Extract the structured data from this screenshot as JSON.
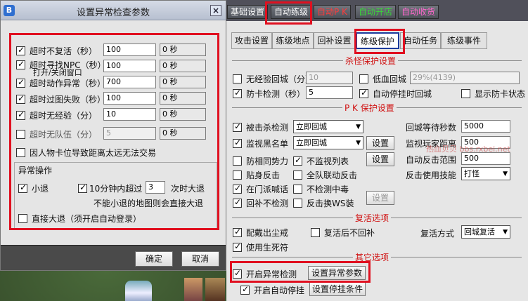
{
  "dialog": {
    "title": "设置异常检查参数",
    "app_icon_text": "B",
    "rows": [
      {
        "label": "超时不复活（秒）",
        "checked": true,
        "value": "100",
        "seconds": "0 秒"
      },
      {
        "label": "超时寻找NPC（秒）",
        "label2": "打开/关闭窗口",
        "checked": true,
        "value": "100",
        "seconds": "0 秒"
      },
      {
        "label": "超时动作异常（秒）",
        "checked": true,
        "value": "700",
        "seconds": "0 秒"
      },
      {
        "label": "超时过图失败（秒）",
        "checked": true,
        "value": "100",
        "seconds": "0 秒"
      },
      {
        "label": "超时无经验（分）",
        "checked": true,
        "value": "10",
        "seconds": "0 秒"
      },
      {
        "label": "超时无队伍（分）",
        "checked": false,
        "value": "5",
        "seconds": "0 秒"
      }
    ],
    "stuck_trade": "因人物卡位导致距离太远无法交易",
    "group_title": "异常操作",
    "small_exit": "小退",
    "exceed_prefix": "10分钟内超过",
    "exceed_value": "3",
    "exceed_suffix": "次时大退",
    "exceed_note": "不能小退的地图则会直接大退",
    "big_exit": "直接大退（须开启自动登录）",
    "ok": "确定",
    "cancel": "取消"
  },
  "panel": {
    "top_tabs": [
      {
        "label": "基础设置",
        "color": "#ffffff"
      },
      {
        "label": "自动练级",
        "color": "#ffffff"
      },
      {
        "label": "自动P K",
        "color": "#ff3a3a"
      },
      {
        "label": "自动开店",
        "color": "#38d838"
      },
      {
        "label": "自动收货",
        "color": "#ff66cc"
      }
    ],
    "sub_tabs": [
      "攻击设置",
      "练级地点",
      "回补设置",
      "练级保护",
      "自动任务",
      "练级事件"
    ],
    "kill_section": "杀怪保护设置",
    "no_exp_back": "无经验回城（分）",
    "no_exp_value": "10",
    "low_hp_back": "低血回城",
    "low_hp_value": "29%(4139)",
    "anti_stuck": "防卡检测（秒）",
    "anti_stuck_value": "5",
    "auto_stop_back": "自动停挂时回城",
    "show_stuck": "显示防卡状态",
    "pk_section": "P K 保护设置",
    "killed_check": "被击杀检测",
    "killed_option": "立即回城",
    "monitor_black": "监视黑名单",
    "monitor_option": "立即回城",
    "set": "设置",
    "guard_same": "防相同势力",
    "no_monitor_list": "不监视列表",
    "close_counter": "贴身反击",
    "all_team": "全队联动反击",
    "faction_shout": "在门派喊话",
    "no_poison": "不检测中毒",
    "back_no_check": "回补不检测",
    "counter_ws": "反击换WS装",
    "wait_back_label": "回城等待秒数",
    "wait_back_value": "5000",
    "monitor_dist_label": "监视玩家距离",
    "monitor_dist_value": "500",
    "auto_counter_label": "自动反击范围",
    "auto_counter_value": "500",
    "counter_skill_label": "反击使用技能",
    "counter_skill_value": "打怪",
    "revive_section": "复活选项",
    "equip_ring": "配戴出尘戒",
    "no_supply": "复活后不回补",
    "revive_method": "复活方式",
    "revive_value": "回城复活",
    "use_charm": "使用生死符",
    "other_section": "其它选项",
    "enable_check": "开启异常检测",
    "set_check_params": "设置异常参数",
    "enable_auto_stop": "开启自动停挂",
    "set_stop_cond": "设置停挂条件",
    "watermark": "热血贝贝 bbs.rxbei.net"
  }
}
